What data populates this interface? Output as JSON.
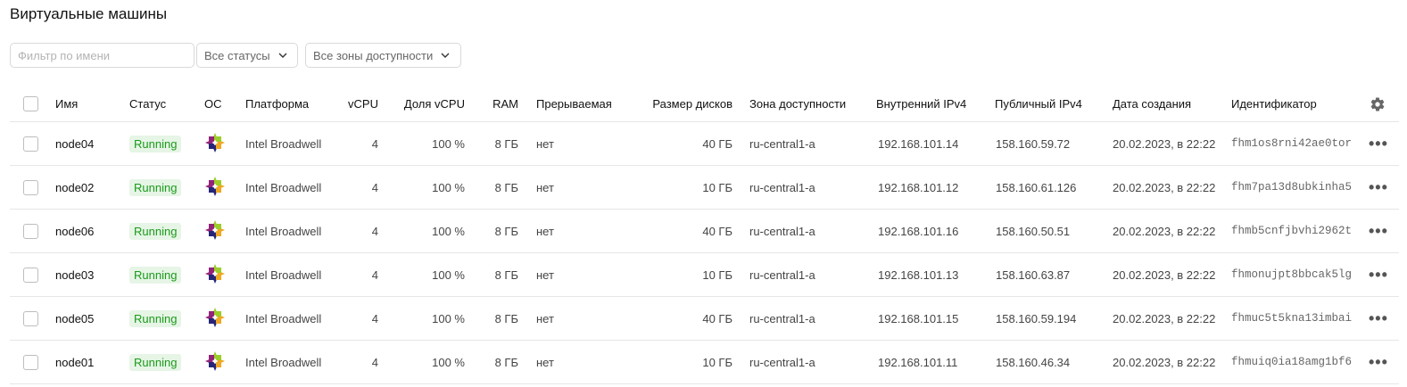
{
  "page": {
    "title": "Виртуальные машины"
  },
  "toolbar": {
    "filter_placeholder": "Фильтр по имени",
    "status_select": "Все статусы",
    "zone_select": "Все зоны доступности"
  },
  "table": {
    "columns": {
      "name": "Имя",
      "status": "Статус",
      "os": "ОС",
      "platform": "Платформа",
      "vcpu": "vCPU",
      "vcpu_share": "Доля vCPU",
      "ram": "RAM",
      "preemptible": "Прерываемая",
      "disk_size": "Размер дисков",
      "zone": "Зона доступности",
      "internal_ip": "Внутренний IPv4",
      "public_ip": "Публичный IPv4",
      "created": "Дата создания",
      "id": "Идентификатор"
    },
    "rows": [
      {
        "name": "node04",
        "status": "Running",
        "platform": "Intel Broadwell",
        "vcpu": "4",
        "vcpu_share": "100 %",
        "ram": "8 ГБ",
        "preemptible": "нет",
        "disk_size": "40 ГБ",
        "zone": "ru-central1-a",
        "internal_ip": "192.168.101.14",
        "public_ip": "158.160.59.72",
        "created": "20.02.2023, в 22:22",
        "id": "fhm1os8rni42ae0tor"
      },
      {
        "name": "node02",
        "status": "Running",
        "platform": "Intel Broadwell",
        "vcpu": "4",
        "vcpu_share": "100 %",
        "ram": "8 ГБ",
        "preemptible": "нет",
        "disk_size": "10 ГБ",
        "zone": "ru-central1-a",
        "internal_ip": "192.168.101.12",
        "public_ip": "158.160.61.126",
        "created": "20.02.2023, в 22:22",
        "id": "fhm7pa13d8ubkinha5"
      },
      {
        "name": "node06",
        "status": "Running",
        "platform": "Intel Broadwell",
        "vcpu": "4",
        "vcpu_share": "100 %",
        "ram": "8 ГБ",
        "preemptible": "нет",
        "disk_size": "40 ГБ",
        "zone": "ru-central1-a",
        "internal_ip": "192.168.101.16",
        "public_ip": "158.160.50.51",
        "created": "20.02.2023, в 22:22",
        "id": "fhmb5cnfjbvhi2962t"
      },
      {
        "name": "node03",
        "status": "Running",
        "platform": "Intel Broadwell",
        "vcpu": "4",
        "vcpu_share": "100 %",
        "ram": "8 ГБ",
        "preemptible": "нет",
        "disk_size": "10 ГБ",
        "zone": "ru-central1-a",
        "internal_ip": "192.168.101.13",
        "public_ip": "158.160.63.87",
        "created": "20.02.2023, в 22:22",
        "id": "fhmonujpt8bbcak5lg"
      },
      {
        "name": "node05",
        "status": "Running",
        "platform": "Intel Broadwell",
        "vcpu": "4",
        "vcpu_share": "100 %",
        "ram": "8 ГБ",
        "preemptible": "нет",
        "disk_size": "40 ГБ",
        "zone": "ru-central1-a",
        "internal_ip": "192.168.101.15",
        "public_ip": "158.160.59.194",
        "created": "20.02.2023, в 22:22",
        "id": "fhmuc5t5kna13imbai"
      },
      {
        "name": "node01",
        "status": "Running",
        "platform": "Intel Broadwell",
        "vcpu": "4",
        "vcpu_share": "100 %",
        "ram": "8 ГБ",
        "preemptible": "нет",
        "disk_size": "10 ГБ",
        "zone": "ru-central1-a",
        "internal_ip": "192.168.101.11",
        "public_ip": "158.160.46.34",
        "created": "20.02.2023, в 22:22",
        "id": "fhmuiq0ia18amg1bf6"
      }
    ]
  },
  "icons": {
    "os": "centos-logo-icon",
    "settings": "gear-icon",
    "actions": "more-actions-icon",
    "dropdown": "chevron-down-icon"
  },
  "colors": {
    "status_running_bg": "#e6f5e6",
    "status_running_text": "#1b9a1b"
  }
}
